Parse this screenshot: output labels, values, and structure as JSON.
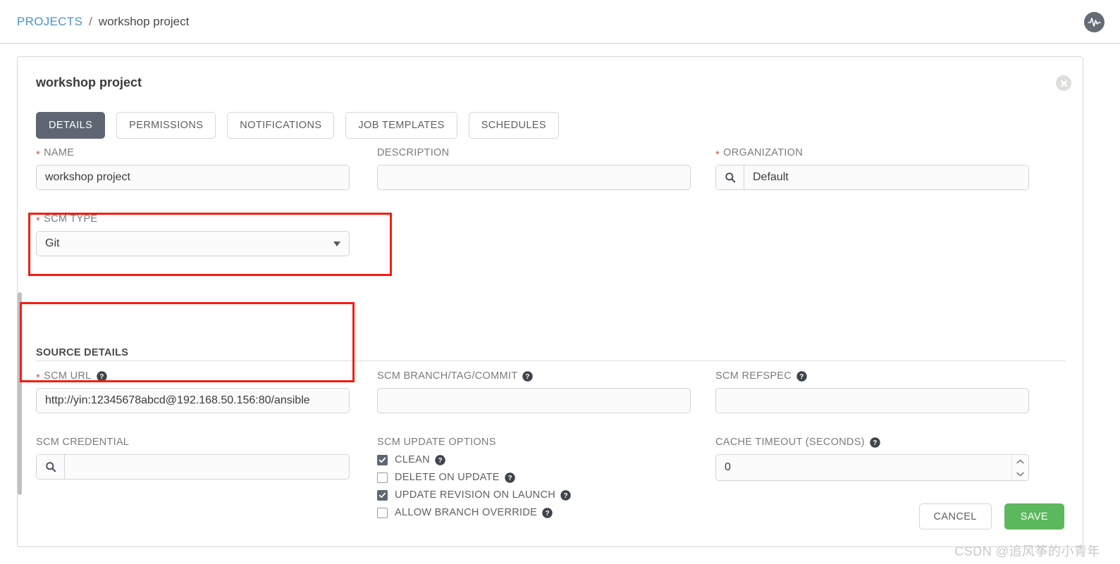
{
  "breadcrumb": {
    "root_label": "PROJECTS",
    "separator": "/",
    "current_label": "workshop project"
  },
  "topbar": {
    "activity_icon": "activity-pulse-icon"
  },
  "card": {
    "title": "workshop project",
    "close_icon": "close-icon"
  },
  "tabs": [
    {
      "label": "DETAILS",
      "active": true
    },
    {
      "label": "PERMISSIONS",
      "active": false
    },
    {
      "label": "NOTIFICATIONS",
      "active": false
    },
    {
      "label": "JOB TEMPLATES",
      "active": false
    },
    {
      "label": "SCHEDULES",
      "active": false
    }
  ],
  "fields": {
    "name": {
      "label": "NAME",
      "required_marker": "*",
      "value": "workshop project",
      "placeholder": ""
    },
    "description": {
      "label": "DESCRIPTION",
      "value": "",
      "placeholder": ""
    },
    "organization": {
      "label": "ORGANIZATION",
      "required_marker": "*",
      "value": "Default",
      "placeholder": "",
      "search_icon": "search-icon"
    },
    "scm_type": {
      "label": "SCM TYPE",
      "required_marker": "*",
      "value": "Git",
      "caret_icon": "chevron-down-icon"
    },
    "scm_url": {
      "label": "SCM URL",
      "required_marker": "*",
      "help_icon": "help-circle-icon",
      "value": "http://yin:12345678abcd@192.168.50.156:80/ansible",
      "placeholder": ""
    },
    "scm_branch": {
      "label": "SCM BRANCH/TAG/COMMIT",
      "help_icon": "help-circle-icon",
      "value": "",
      "placeholder": ""
    },
    "scm_refspec": {
      "label": "SCM REFSPEC",
      "help_icon": "help-circle-icon",
      "value": "",
      "placeholder": ""
    },
    "scm_credential": {
      "label": "SCM CREDENTIAL",
      "value": "",
      "placeholder": "",
      "search_icon": "search-icon"
    },
    "cache_timeout": {
      "label": "CACHE TIMEOUT (SECONDS)",
      "help_icon": "help-circle-icon",
      "value": "0",
      "placeholder": ""
    }
  },
  "source_details": {
    "heading": "SOURCE DETAILS"
  },
  "scm_update_options": {
    "label": "SCM UPDATE OPTIONS",
    "items": [
      {
        "label": "CLEAN",
        "checked": true,
        "help_icon": "help-circle-icon"
      },
      {
        "label": "DELETE ON UPDATE",
        "checked": false,
        "help_icon": "help-circle-icon"
      },
      {
        "label": "UPDATE REVISION ON LAUNCH",
        "checked": true,
        "help_icon": "help-circle-icon"
      },
      {
        "label": "ALLOW BRANCH OVERRIDE",
        "checked": false,
        "help_icon": "help-circle-icon"
      }
    ]
  },
  "footer": {
    "cancel_label": "CANCEL",
    "save_label": "SAVE"
  },
  "watermark": {
    "text": "CSDN @追风筝的小青年"
  },
  "colors": {
    "link": "#4d93c4",
    "required_star": "#d9534f",
    "tab_active_bg": "#5f6673",
    "save_green": "#5cb85c",
    "annotation_red": "#f81b12"
  }
}
